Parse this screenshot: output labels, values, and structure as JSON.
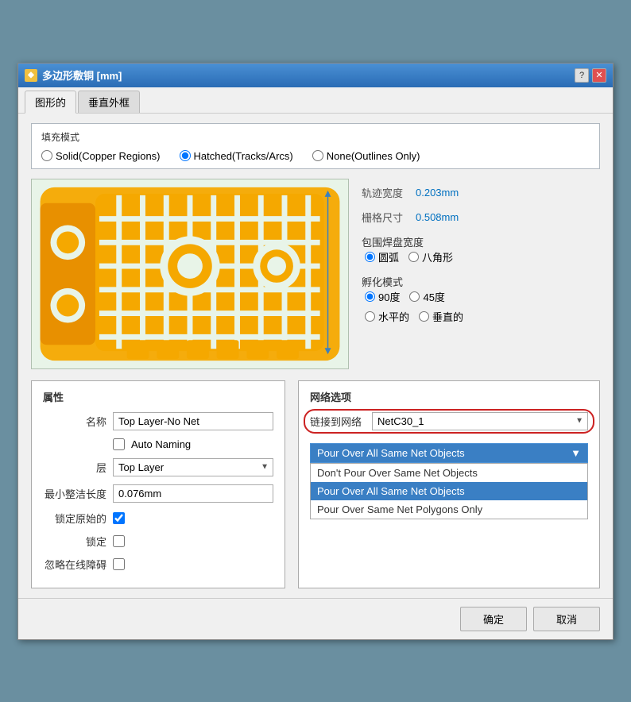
{
  "window": {
    "title": "多边形敷铜 [mm]",
    "icon": "◆"
  },
  "tabs": [
    {
      "label": "图形的",
      "active": true
    },
    {
      "label": "垂直外框",
      "active": false
    }
  ],
  "fill_mode": {
    "label": "填充模式",
    "options": [
      {
        "label": "Solid(Copper Regions)",
        "checked": false
      },
      {
        "label": "Hatched(Tracks/Arcs)",
        "checked": true
      },
      {
        "label": "None(Outlines Only)",
        "checked": false
      }
    ]
  },
  "params": {
    "track_width_label": "轨迹宽度",
    "track_width_value": "0.203mm",
    "grid_size_label": "栅格尺寸",
    "grid_size_value": "0.508mm",
    "surround_label": "包围焊盘宽度",
    "surround_options": [
      {
        "label": "圆弧",
        "checked": true
      },
      {
        "label": "八角形",
        "checked": false
      }
    ],
    "hatch_label": "孵化模式",
    "hatch_options_row1": [
      {
        "label": "90度",
        "checked": true
      },
      {
        "label": "45度",
        "checked": false
      }
    ],
    "hatch_options_row2": [
      {
        "label": "水平的",
        "checked": false
      },
      {
        "label": "垂直的",
        "checked": false
      }
    ]
  },
  "properties": {
    "title": "属性",
    "name_label": "名称",
    "name_value": "Top Layer-No Net",
    "auto_naming_label": "Auto Naming",
    "auto_naming_checked": false,
    "layer_label": "层",
    "layer_value": "Top Layer",
    "min_length_label": "最小整洁长度",
    "min_length_value": "0.076mm",
    "lock_origin_label": "锁定原始的",
    "lock_origin_checked": true,
    "lock_label": "锁定",
    "lock_checked": false,
    "ignore_label": "忽略在线障碍",
    "ignore_checked": false
  },
  "network": {
    "title": "网络选项",
    "link_label": "链接到网络",
    "link_value": "NetC30_1",
    "dropdown_selected": "Pour Over All Same Net Objects",
    "dropdown_options": [
      "Don't Pour Over Same Net Objects",
      "Pour Over All Same Net Objects",
      "Pour Over Same Net Polygons Only"
    ]
  },
  "footer": {
    "confirm_label": "确定",
    "cancel_label": "取消"
  }
}
